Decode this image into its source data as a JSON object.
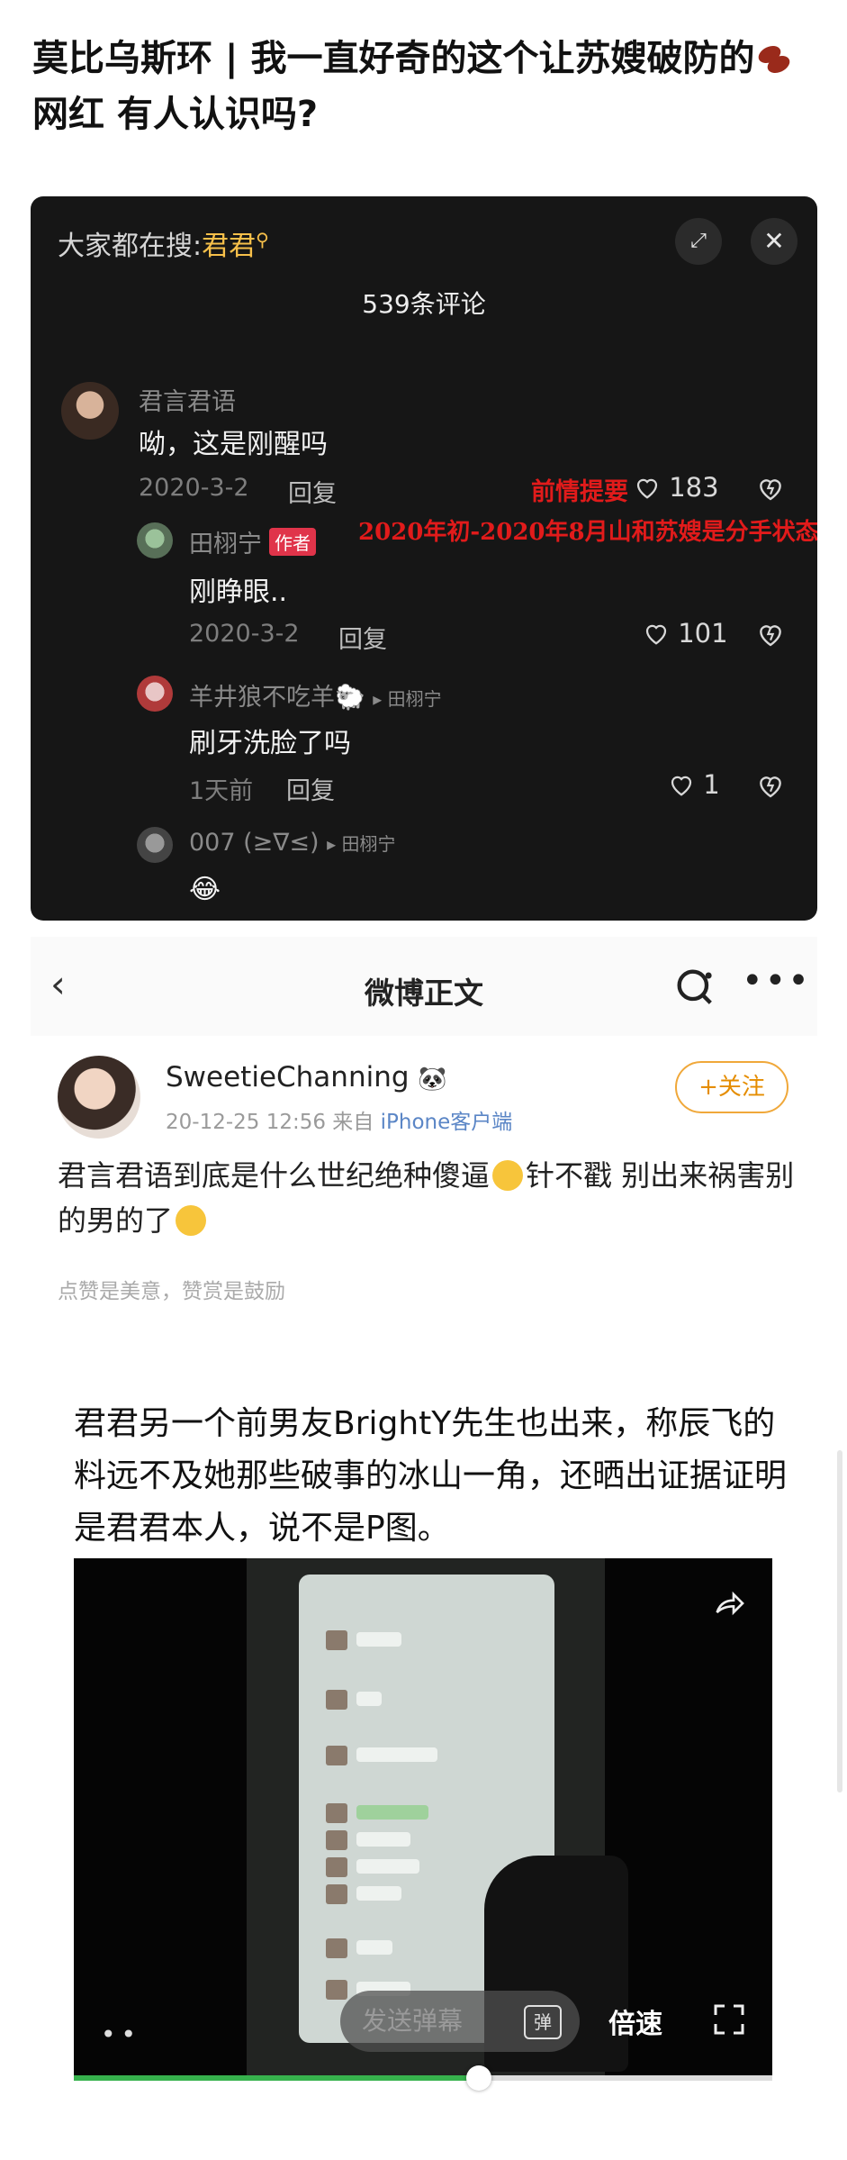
{
  "title": {
    "part1": "莫比乌斯环 | 我一直好奇的这个让苏嫂破防的",
    "part2": "网红 有人认识吗?"
  },
  "comments_panel": {
    "search_label": "大家都在搜:",
    "search_term": "君君",
    "comment_count": "539条评论",
    "comments": [
      {
        "user": "君言君语",
        "text": "呦，这是刚醒吗",
        "date": "2020-3-2",
        "reply": "回复",
        "likes": "183"
      },
      {
        "user": "田栩宁",
        "badge": "作者",
        "text": "刚睁眼..",
        "date": "2020-3-2",
        "reply": "回复",
        "likes": "101"
      },
      {
        "user": "羊井狼不吃羊🐑",
        "reply_to": "▸ 田栩宁",
        "text": "刷牙洗脸了吗",
        "date": "1天前",
        "reply": "回复",
        "likes": "1"
      },
      {
        "user": "007 (≥∇≤)",
        "reply_to": "▸ 田栩宁",
        "text": "😂"
      }
    ],
    "annotation_line1": "前情提要",
    "annotation_line2": "2020年初-2020年8月山和苏嫂是分手状态"
  },
  "weibo": {
    "back_icon": "‹",
    "title": "微博正文",
    "more_icon": "•••",
    "username": "SweetieChanning",
    "time": "20-12-25 12:56  来自 ",
    "source": "iPhone客户端",
    "follow": "+关注",
    "text_part1": "君言君语到底是什么世纪绝种傻逼",
    "text_part2": "针不戳 别出来祸害别的男的了",
    "footer": "点赞是美意，赞赏是鼓励"
  },
  "article_text": "君君另一个前男友BrightY先生也出来，称辰飞的料远不及她那些破事的冰山一角，还晒出证据证明是君君本人，说不是P图。",
  "video": {
    "danmaku_placeholder": "发送弹幕",
    "danmaku_icon": "弹",
    "speed": "倍速",
    "progress": 0.58
  },
  "colors": {
    "panel_bg": "#161616",
    "search_term": "#f7c04a",
    "author_badge": "#e0344a",
    "annotation": "#e11b1b",
    "follow": "#e58d00",
    "progress": "#37b24d"
  }
}
